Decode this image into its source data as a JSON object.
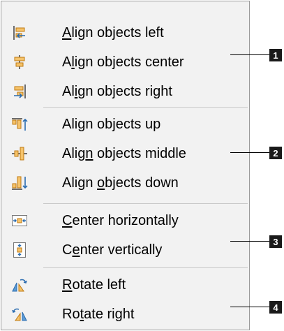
{
  "menu": {
    "groups": [
      {
        "badge": "1",
        "items": [
          {
            "icon": "align-left-icon",
            "pre": "",
            "u": "A",
            "post": "lign objects left"
          },
          {
            "icon": "align-center-icon",
            "pre": "A",
            "u": "l",
            "post": "ign objects center"
          },
          {
            "icon": "align-right-icon",
            "pre": "Al",
            "u": "i",
            "post": "gn objects right"
          }
        ]
      },
      {
        "badge": "2",
        "items": [
          {
            "icon": "align-top-icon",
            "pre": "Ali",
            "u": "g",
            "post": "n objects up"
          },
          {
            "icon": "align-middle-icon",
            "pre": "Alig",
            "u": "n",
            "post": " objects middle"
          },
          {
            "icon": "align-bottom-icon",
            "pre": "Align ",
            "u": "o",
            "post": "bjects down"
          }
        ]
      },
      {
        "badge": "3",
        "items": [
          {
            "icon": "center-horizontally-icon",
            "pre": "",
            "u": "C",
            "post": "enter horizontally"
          },
          {
            "icon": "center-vertically-icon",
            "pre": "C",
            "u": "e",
            "post": "nter vertically"
          }
        ]
      },
      {
        "badge": "4",
        "items": [
          {
            "icon": "rotate-left-icon",
            "pre": "",
            "u": "R",
            "post": "otate left"
          },
          {
            "icon": "rotate-right-icon",
            "pre": "Ro",
            "u": "t",
            "post": "ate right"
          }
        ]
      }
    ]
  },
  "colors": {
    "menu_bg": "#f2f2f2",
    "icon_blue": "#2b6cb0",
    "icon_orange": "#e8a030",
    "icon_gray": "#6d6d6d",
    "badge_bg": "#1a1a1a"
  }
}
